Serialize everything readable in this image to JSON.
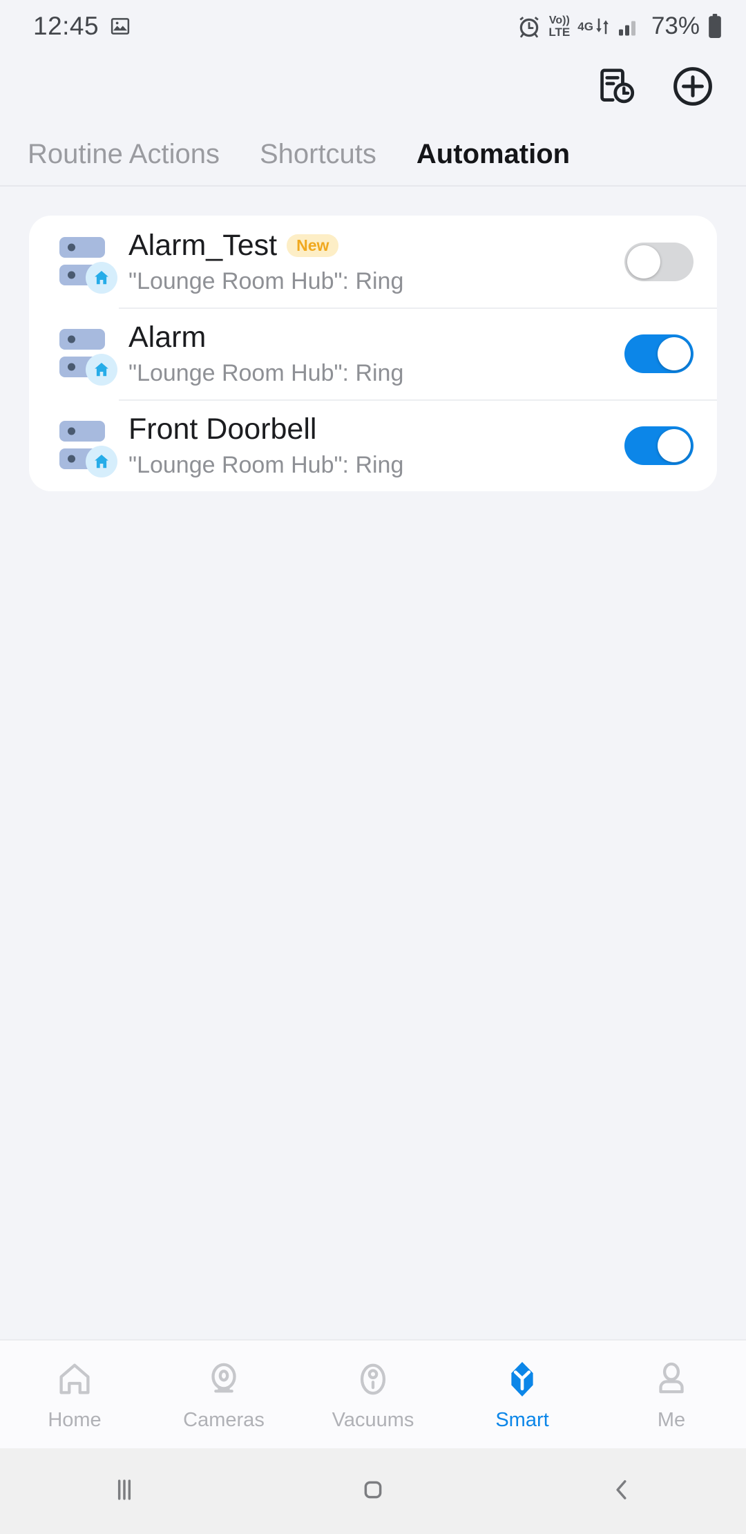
{
  "status_bar": {
    "time": "12:45",
    "left_icons": [
      "image-icon"
    ],
    "right_icons": [
      "alarm-icon",
      "volte-icon",
      "4g-data-icon",
      "signal-icon"
    ],
    "volte_top": "Vo))",
    "volte_bottom": "LTE",
    "network_type": "4G",
    "battery_percent": "73%"
  },
  "header": {
    "actions": [
      {
        "name": "log-history-button",
        "icon": "document-clock-icon"
      },
      {
        "name": "add-button",
        "icon": "plus-circle-icon"
      }
    ]
  },
  "tabs": [
    {
      "label": "Routine Actions",
      "active": false
    },
    {
      "label": "Shortcuts",
      "active": false
    },
    {
      "label": "Automation",
      "active": true
    }
  ],
  "automations": [
    {
      "title": "Alarm_Test",
      "badge": "New",
      "subtitle": "\"Lounge Room Hub\": Ring",
      "enabled": false,
      "icon": "hub-home-icon"
    },
    {
      "title": "Alarm",
      "badge": "",
      "subtitle": "\"Lounge Room Hub\": Ring",
      "enabled": true,
      "icon": "hub-home-icon"
    },
    {
      "title": "Front Doorbell",
      "badge": "",
      "subtitle": "\"Lounge Room Hub\": Ring",
      "enabled": true,
      "icon": "hub-home-icon"
    }
  ],
  "bottom_nav": [
    {
      "label": "Home",
      "icon": "house-icon",
      "active": false
    },
    {
      "label": "Cameras",
      "icon": "camera-icon",
      "active": false
    },
    {
      "label": "Vacuums",
      "icon": "vacuum-icon",
      "active": false
    },
    {
      "label": "Smart",
      "icon": "smart-cube-icon",
      "active": true
    },
    {
      "label": "Me",
      "icon": "person-icon",
      "active": false
    }
  ],
  "android_nav": [
    {
      "name": "recents-button",
      "icon": "recents-icon"
    },
    {
      "name": "home-button",
      "icon": "home-square-icon"
    },
    {
      "name": "back-button",
      "icon": "back-chevron-icon"
    }
  ],
  "colors": {
    "accent": "#0c86e8",
    "badge_bg": "#fdeec6",
    "badge_text": "#f0a81e",
    "page_bg": "#f3f4f8",
    "card_bg": "#ffffff"
  }
}
